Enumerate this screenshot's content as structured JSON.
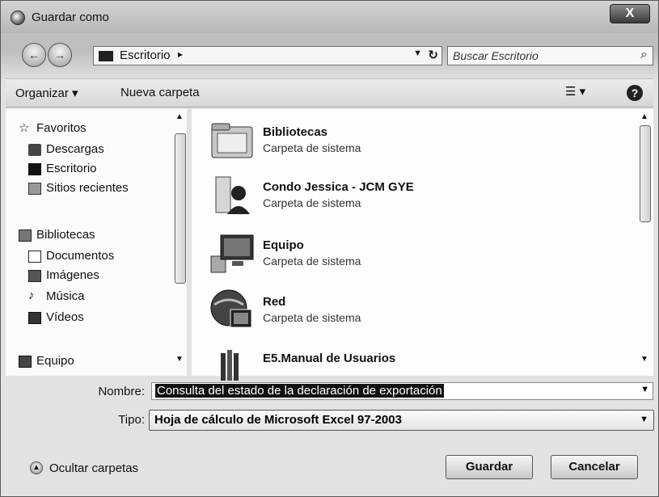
{
  "window": {
    "title": "Guardar como",
    "close_glyph": "X"
  },
  "address": {
    "back_glyph": "←",
    "forward_glyph": "→",
    "location": "Escritorio",
    "separator": "▸",
    "dropdown": "▼",
    "refresh_glyph": "↻",
    "search_placeholder": "Buscar Escritorio",
    "search_icon": "search-icon"
  },
  "toolbar": {
    "organize_label": "Organizar ▾",
    "new_folder_label": "Nueva carpeta",
    "view_label": "☰ ▾",
    "help_label": "?"
  },
  "sidebar": {
    "items": [
      {
        "label": "Favoritos",
        "icon": "star-icon"
      },
      {
        "label": "Descargas",
        "icon": "downloads-icon"
      },
      {
        "label": "Escritorio",
        "icon": "desktop-icon"
      },
      {
        "label": "Sitios recientes",
        "icon": "recent-places-icon"
      },
      {
        "label": "Bibliotecas",
        "icon": "libraries-icon"
      },
      {
        "label": "Documentos",
        "icon": "documents-icon"
      },
      {
        "label": "Imágenes",
        "icon": "pictures-icon"
      },
      {
        "label": "Música",
        "icon": "music-icon"
      },
      {
        "label": "Vídeos",
        "icon": "videos-icon"
      },
      {
        "label": "Equipo",
        "icon": "computer-icon"
      }
    ]
  },
  "files": [
    {
      "name": "Bibliotecas",
      "desc": "Carpeta de sistema",
      "icon": "libraries-folder-icon"
    },
    {
      "name": "Condo Jessica - JCM GYE",
      "desc": "Carpeta de sistema",
      "icon": "user-folder-icon"
    },
    {
      "name": "Equipo",
      "desc": "Carpeta de sistema",
      "icon": "computer-icon"
    },
    {
      "name": "Red",
      "desc": "Carpeta de sistema",
      "icon": "network-icon"
    },
    {
      "name": "E5.Manual de Usuarios",
      "desc": "",
      "icon": "library-folder-icon"
    }
  ],
  "form": {
    "name_label": "Nombre:",
    "name_value": "Consulta del estado de la declaración de exportación",
    "type_label": "Tipo:",
    "type_value": "Hoja de cálculo de Microsoft Excel 97-2003"
  },
  "footer": {
    "hide_folders_label": "Ocultar carpetas",
    "hide_folders_glyph": "▲",
    "save_label": "Guardar",
    "cancel_label": "Cancelar"
  },
  "colors": {
    "selection_bg": "#111111",
    "selection_fg": "#ffffff"
  }
}
